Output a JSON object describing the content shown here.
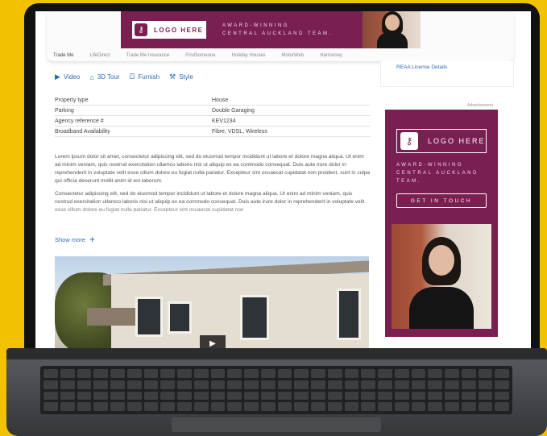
{
  "banner": {
    "logo_text": "LOGO HERE",
    "tagline_line1": "AWARD-WINNING",
    "tagline_line2": "CENTRAL AUCKLAND TEAM."
  },
  "nav": {
    "tabs": [
      "Trade Me",
      "LifeDirect",
      "Trade Me Insurance",
      "FindSomeone",
      "Holiday Houses",
      "MotorWeb",
      "Harmoney"
    ]
  },
  "sidebar": {
    "reaa_link": "REAA License Details",
    "ad_label": "Advertisement"
  },
  "features": {
    "video": "Video",
    "tour": "3D Tour",
    "furnish": "Furnish",
    "style": "Style"
  },
  "details": [
    {
      "key": "Property type",
      "value": "House"
    },
    {
      "key": "Parking",
      "value": "Double Garaging"
    },
    {
      "key": "Agency reference #",
      "value": "KEV1234"
    },
    {
      "key": "Broadband Availability",
      "value": "Fibre, VDSL, Wireless"
    }
  ],
  "description": {
    "p1": "Lorem ipsum dolor sit amet, consectetur adipiscing elit, sed do eiusmod tempor incididunt ut labore et dolore magna aliqua. Ut enim ad minim veniam, quis nostrud exercitation ullamco laboris nisi ut aliquip ex ea commodo consequat. Duis aute irure dolor in reprehenderit in voluptate velit esse cillum dolore eu fugiat nulla pariatur. Excepteur sint occaecat cupidatat non proident, sunt in culpa qui officia deserunt mollit anim id est laborum.",
    "p2": "Consectetur adipiscing elit, sed do eiusmod tempor incididunt ut labore et dolore magna aliqua. Ut enim ad minim veniam, quis nostrud exercitation ullamco laboris nisi ut aliquip ex ea commodo consequat. Duis aute irure dolor in reprehenderit in voluptate velit esse cillum dolore eu fugiat nulla pariatur. Excepteur sint occaecat cupidatat non",
    "show_more": "Show more"
  },
  "ad": {
    "logo_text": "LOGO HERE",
    "tagline_line1": "AWARD-WINNING",
    "tagline_line2": "CENTRAL AUCKLAND",
    "tagline_line3": "TEAM.",
    "cta": "GET IN TOUCH"
  },
  "colors": {
    "brand_accent": "#7a1f52",
    "link": "#2d6bb5",
    "background": "#f2c200"
  }
}
